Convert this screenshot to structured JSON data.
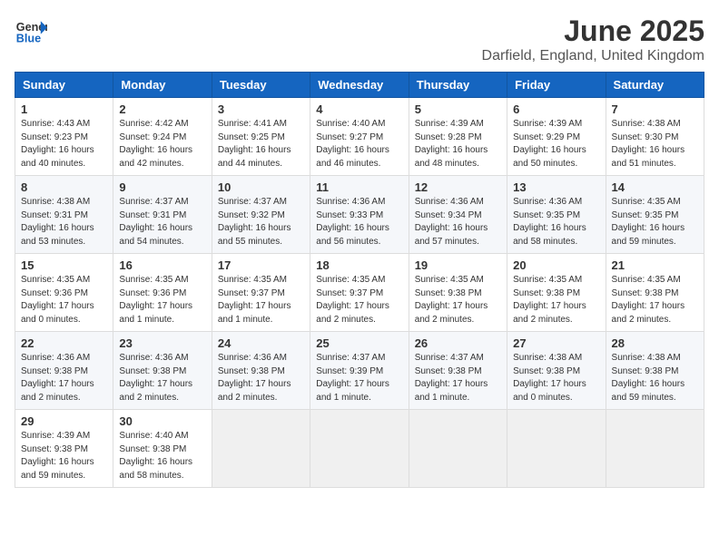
{
  "header": {
    "logo_general": "General",
    "logo_blue": "Blue",
    "month": "June 2025",
    "location": "Darfield, England, United Kingdom"
  },
  "days_of_week": [
    "Sunday",
    "Monday",
    "Tuesday",
    "Wednesday",
    "Thursday",
    "Friday",
    "Saturday"
  ],
  "weeks": [
    [
      {
        "day": "1",
        "info": "Sunrise: 4:43 AM\nSunset: 9:23 PM\nDaylight: 16 hours\nand 40 minutes."
      },
      {
        "day": "2",
        "info": "Sunrise: 4:42 AM\nSunset: 9:24 PM\nDaylight: 16 hours\nand 42 minutes."
      },
      {
        "day": "3",
        "info": "Sunrise: 4:41 AM\nSunset: 9:25 PM\nDaylight: 16 hours\nand 44 minutes."
      },
      {
        "day": "4",
        "info": "Sunrise: 4:40 AM\nSunset: 9:27 PM\nDaylight: 16 hours\nand 46 minutes."
      },
      {
        "day": "5",
        "info": "Sunrise: 4:39 AM\nSunset: 9:28 PM\nDaylight: 16 hours\nand 48 minutes."
      },
      {
        "day": "6",
        "info": "Sunrise: 4:39 AM\nSunset: 9:29 PM\nDaylight: 16 hours\nand 50 minutes."
      },
      {
        "day": "7",
        "info": "Sunrise: 4:38 AM\nSunset: 9:30 PM\nDaylight: 16 hours\nand 51 minutes."
      }
    ],
    [
      {
        "day": "8",
        "info": "Sunrise: 4:38 AM\nSunset: 9:31 PM\nDaylight: 16 hours\nand 53 minutes."
      },
      {
        "day": "9",
        "info": "Sunrise: 4:37 AM\nSunset: 9:31 PM\nDaylight: 16 hours\nand 54 minutes."
      },
      {
        "day": "10",
        "info": "Sunrise: 4:37 AM\nSunset: 9:32 PM\nDaylight: 16 hours\nand 55 minutes."
      },
      {
        "day": "11",
        "info": "Sunrise: 4:36 AM\nSunset: 9:33 PM\nDaylight: 16 hours\nand 56 minutes."
      },
      {
        "day": "12",
        "info": "Sunrise: 4:36 AM\nSunset: 9:34 PM\nDaylight: 16 hours\nand 57 minutes."
      },
      {
        "day": "13",
        "info": "Sunrise: 4:36 AM\nSunset: 9:35 PM\nDaylight: 16 hours\nand 58 minutes."
      },
      {
        "day": "14",
        "info": "Sunrise: 4:35 AM\nSunset: 9:35 PM\nDaylight: 16 hours\nand 59 minutes."
      }
    ],
    [
      {
        "day": "15",
        "info": "Sunrise: 4:35 AM\nSunset: 9:36 PM\nDaylight: 17 hours\nand 0 minutes."
      },
      {
        "day": "16",
        "info": "Sunrise: 4:35 AM\nSunset: 9:36 PM\nDaylight: 17 hours\nand 1 minute."
      },
      {
        "day": "17",
        "info": "Sunrise: 4:35 AM\nSunset: 9:37 PM\nDaylight: 17 hours\nand 1 minute."
      },
      {
        "day": "18",
        "info": "Sunrise: 4:35 AM\nSunset: 9:37 PM\nDaylight: 17 hours\nand 2 minutes."
      },
      {
        "day": "19",
        "info": "Sunrise: 4:35 AM\nSunset: 9:38 PM\nDaylight: 17 hours\nand 2 minutes."
      },
      {
        "day": "20",
        "info": "Sunrise: 4:35 AM\nSunset: 9:38 PM\nDaylight: 17 hours\nand 2 minutes."
      },
      {
        "day": "21",
        "info": "Sunrise: 4:35 AM\nSunset: 9:38 PM\nDaylight: 17 hours\nand 2 minutes."
      }
    ],
    [
      {
        "day": "22",
        "info": "Sunrise: 4:36 AM\nSunset: 9:38 PM\nDaylight: 17 hours\nand 2 minutes."
      },
      {
        "day": "23",
        "info": "Sunrise: 4:36 AM\nSunset: 9:38 PM\nDaylight: 17 hours\nand 2 minutes."
      },
      {
        "day": "24",
        "info": "Sunrise: 4:36 AM\nSunset: 9:38 PM\nDaylight: 17 hours\nand 2 minutes."
      },
      {
        "day": "25",
        "info": "Sunrise: 4:37 AM\nSunset: 9:39 PM\nDaylight: 17 hours\nand 1 minute."
      },
      {
        "day": "26",
        "info": "Sunrise: 4:37 AM\nSunset: 9:38 PM\nDaylight: 17 hours\nand 1 minute."
      },
      {
        "day": "27",
        "info": "Sunrise: 4:38 AM\nSunset: 9:38 PM\nDaylight: 17 hours\nand 0 minutes."
      },
      {
        "day": "28",
        "info": "Sunrise: 4:38 AM\nSunset: 9:38 PM\nDaylight: 16 hours\nand 59 minutes."
      }
    ],
    [
      {
        "day": "29",
        "info": "Sunrise: 4:39 AM\nSunset: 9:38 PM\nDaylight: 16 hours\nand 59 minutes."
      },
      {
        "day": "30",
        "info": "Sunrise: 4:40 AM\nSunset: 9:38 PM\nDaylight: 16 hours\nand 58 minutes."
      },
      null,
      null,
      null,
      null,
      null
    ]
  ]
}
